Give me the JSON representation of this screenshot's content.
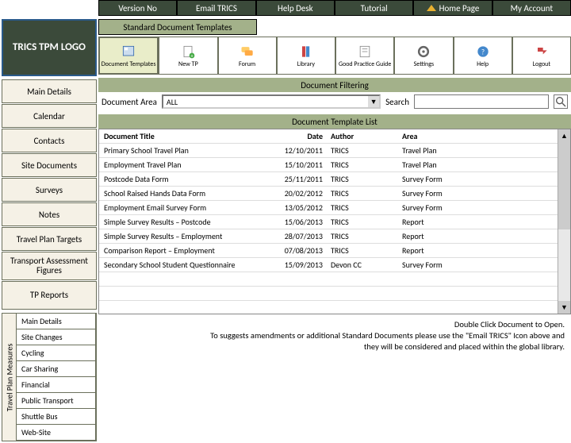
{
  "topbar": {
    "version": "Version No",
    "email": "Email TRICS",
    "help": "Help Desk",
    "tutorial": "Tutorial",
    "home": "Home Page",
    "account": "My Account"
  },
  "logo": "TRICS TPM LOGO",
  "nav": [
    "Main Details",
    "Calendar",
    "Contacts",
    "Site Documents",
    "Surveys",
    "Notes",
    "Travel Plan Targets",
    "Transport Assessment Figures",
    "TP Reports"
  ],
  "measures_label": "Travel Plan Measures",
  "measures": [
    "Main Details",
    "Site Changes",
    "Cycling",
    "Car Sharing",
    "Financial",
    "Public Transport",
    "Shuttle Bus",
    "Web-Site"
  ],
  "std_header": "Standard Document Templates",
  "icons": [
    "Document Templates",
    "New TP",
    "Forum",
    "Library",
    "Good Practice Guide",
    "Settings",
    "Help",
    "Logout"
  ],
  "filter": {
    "title": "Document Filtering",
    "area_label": "Document Area",
    "area_value": "ALL",
    "search_label": "Search"
  },
  "list": {
    "title": "Document Template List",
    "cols": [
      "Document Title",
      "Date",
      "Author",
      "Area"
    ],
    "rows": [
      [
        "Primary School Travel Plan",
        "12/10/2011",
        "TRICS",
        "Travel Plan"
      ],
      [
        "Employment Travel Plan",
        "15/10/2011",
        "TRICS",
        "Travel Plan"
      ],
      [
        "Postcode Data Form",
        "25/11/2011",
        "TRICS",
        "Survey Form"
      ],
      [
        "School Raised Hands Data Form",
        "20/02/2012",
        "TRICS",
        "Survey Form"
      ],
      [
        "Employment Email Survey Form",
        "13/05/2012",
        "TRICS",
        "Survey Form"
      ],
      [
        "Simple Survey Results – Postcode",
        "15/06/2013",
        "TRICS",
        "Report"
      ],
      [
        "Simple Survey Results – Employment",
        "28/07/2013",
        "TRICS",
        "Report"
      ],
      [
        "Comparison Report – Employment",
        "07/08/2013",
        "TRICS",
        "Report"
      ],
      [
        "Secondary School Student Questionnaire",
        "15/09/2013",
        "Devon CC",
        "Survey Form"
      ]
    ]
  },
  "footnote": {
    "l1": "Double Click Document to Open.",
    "l2": "To suggests amendments or additional Standard Documents please use the \"Email TRICS\" Icon above and",
    "l3": "they will be considered and placed within the global library."
  }
}
